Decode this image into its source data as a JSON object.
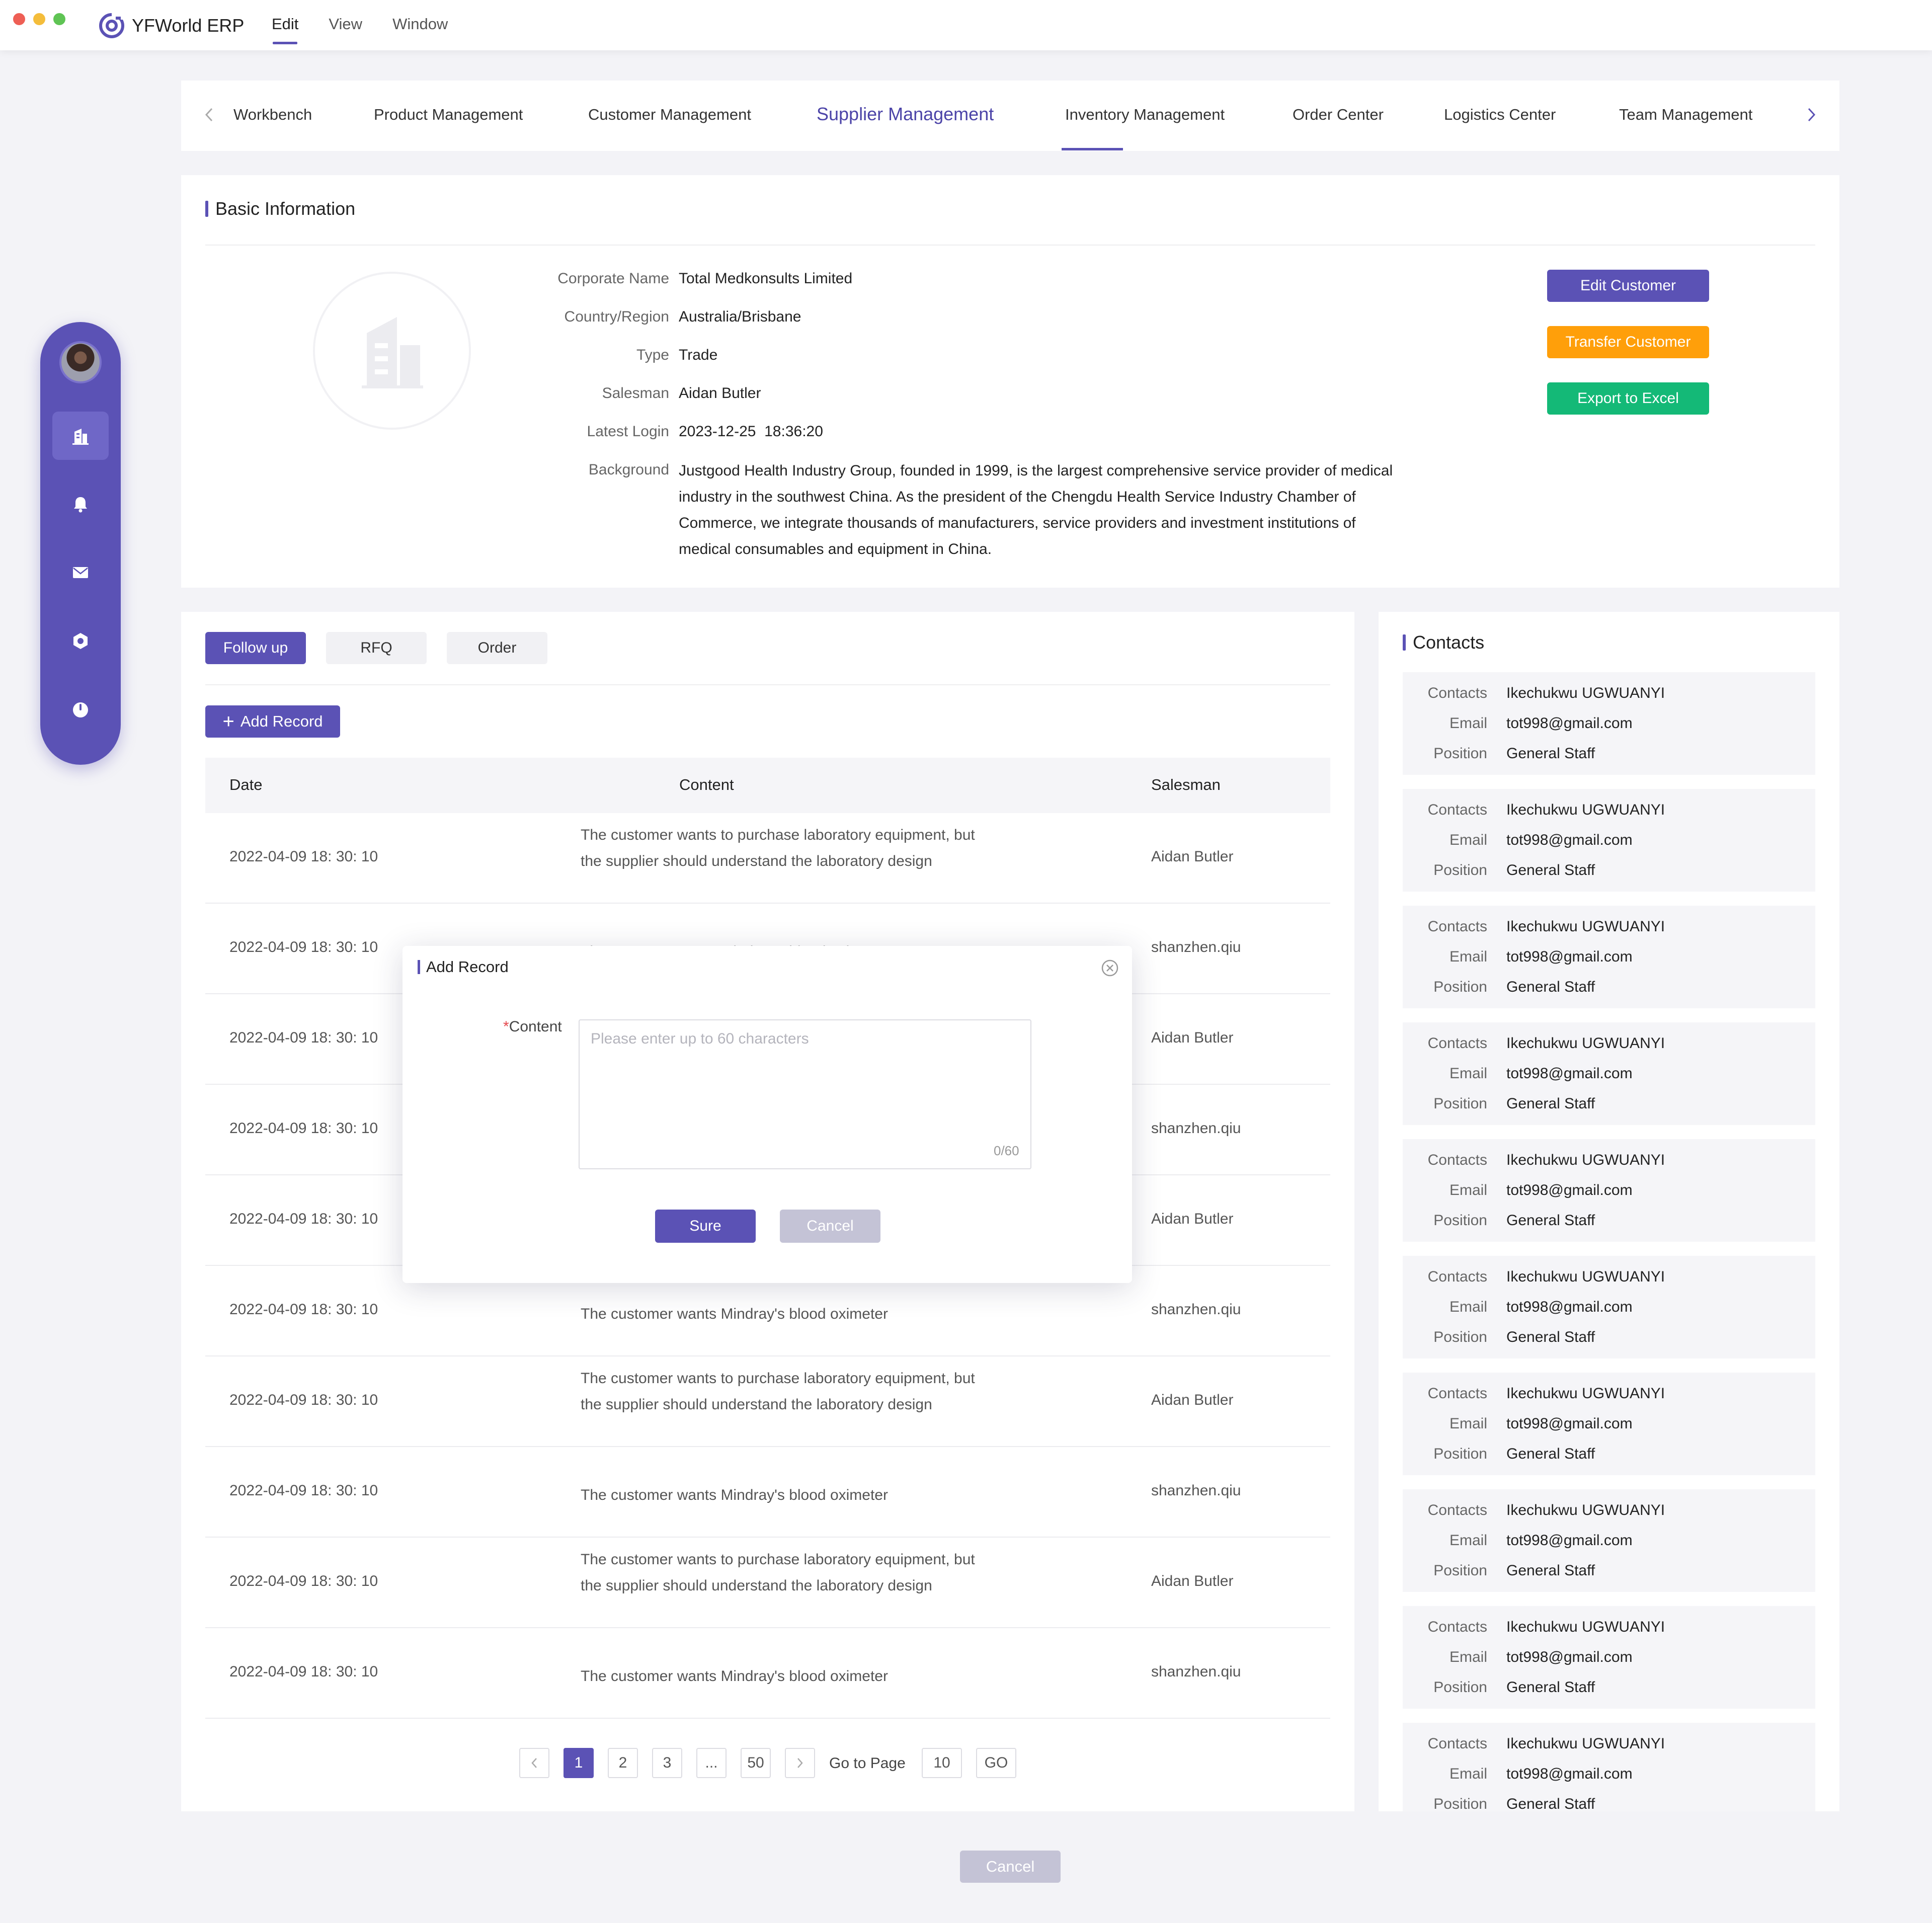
{
  "app": {
    "name": "YFWorld ERP",
    "menu": [
      "Edit",
      "View",
      "Window"
    ]
  },
  "nav": {
    "tabs": [
      "Workbench",
      "Product Management",
      "Customer Management",
      "Supplier Management",
      "Inventory Management",
      "Order Center",
      "Logistics Center",
      "Team Management"
    ],
    "active": "Supplier Management"
  },
  "rail": {
    "icons": [
      "building-icon",
      "bell-icon",
      "mail-icon",
      "settings-icon",
      "power-icon"
    ],
    "active": "building-icon"
  },
  "basic": {
    "title": "Basic Information",
    "fields": [
      {
        "label": "Corporate Name",
        "value": "Total Medkonsults Limited"
      },
      {
        "label": "Country/Region",
        "value": "Australia/Brisbane"
      },
      {
        "label": "Type",
        "value": "Trade"
      },
      {
        "label": "Salesman",
        "value": "Aidan Butler"
      },
      {
        "label": "Latest Login",
        "value": "2023-12-25  18:36:20"
      }
    ],
    "background_label": "Background",
    "background": "Justgood Health Industry Group, founded in 1999, is the largest comprehensive service provider of medical industry in the southwest China. As the president of the Chengdu Health Service Industry Chamber of Commerce, we integrate thousands of manufacturers, service providers and investment institutions of medical consumables and equipment in China.",
    "buttons": {
      "edit": "Edit Customer",
      "transfer": "Transfer Customer",
      "export": "Export to Excel"
    }
  },
  "records": {
    "tabs": [
      "Follow up",
      "RFQ",
      "Order"
    ],
    "active_tab": "Follow up",
    "add_label": "Add Record",
    "columns": [
      "Date",
      "Content",
      "Salesman"
    ],
    "rows": [
      {
        "date": "2022-04-09 18: 30: 10",
        "content": "The customer wants to purchase laboratory equipment, but the supplier should understand the laboratory design",
        "salesman": "Aidan Butler"
      },
      {
        "date": "2022-04-09 18: 30: 10",
        "content": "The customer wants Mindray's blood oximeter",
        "salesman": "shanzhen.qiu"
      },
      {
        "date": "2022-04-09 18: 30: 10",
        "content": "",
        "salesman": "Aidan Butler"
      },
      {
        "date": "2022-04-09 18: 30: 10",
        "content": "",
        "salesman": "shanzhen.qiu"
      },
      {
        "date": "2022-04-09 18: 30: 10",
        "content": "",
        "salesman": "Aidan Butler"
      },
      {
        "date": "2022-04-09 18: 30: 10",
        "content": "The customer wants Mindray's blood oximeter",
        "salesman": "shanzhen.qiu"
      },
      {
        "date": "2022-04-09 18: 30: 10",
        "content": "The customer wants to purchase laboratory equipment, but the supplier should understand the laboratory design",
        "salesman": "Aidan Butler"
      },
      {
        "date": "2022-04-09 18: 30: 10",
        "content": "The customer wants Mindray's blood oximeter",
        "salesman": "shanzhen.qiu"
      },
      {
        "date": "2022-04-09 18: 30: 10",
        "content": "The customer wants to purchase laboratory equipment, but the supplier should understand the laboratory design",
        "salesman": "Aidan Butler"
      },
      {
        "date": "2022-04-09 18: 30: 10",
        "content": "The customer wants Mindray's blood oximeter",
        "salesman": "shanzhen.qiu"
      }
    ],
    "pagination": {
      "pages": [
        "1",
        "2",
        "3",
        "...",
        "50"
      ],
      "current": "1",
      "goto_label": "Go to Page",
      "goto_value": "10",
      "go_label": "GO"
    }
  },
  "contacts": {
    "title": "Contacts",
    "labels": {
      "contact": "Contacts",
      "email": "Email",
      "position": "Position"
    },
    "items": [
      {
        "name": "Ikechukwu UGWUANYI",
        "email": "tot998@gmail.com",
        "position": "General Staff"
      },
      {
        "name": "Ikechukwu UGWUANYI",
        "email": "tot998@gmail.com",
        "position": "General Staff"
      },
      {
        "name": "Ikechukwu UGWUANYI",
        "email": "tot998@gmail.com",
        "position": "General Staff"
      },
      {
        "name": "Ikechukwu UGWUANYI",
        "email": "tot998@gmail.com",
        "position": "General Staff"
      },
      {
        "name": "Ikechukwu UGWUANYI",
        "email": "tot998@gmail.com",
        "position": "General Staff"
      },
      {
        "name": "Ikechukwu UGWUANYI",
        "email": "tot998@gmail.com",
        "position": "General Staff"
      },
      {
        "name": "Ikechukwu UGWUANYI",
        "email": "tot998@gmail.com",
        "position": "General Staff"
      },
      {
        "name": "Ikechukwu UGWUANYI",
        "email": "tot998@gmail.com",
        "position": "General Staff"
      },
      {
        "name": "Ikechukwu UGWUANYI",
        "email": "tot998@gmail.com",
        "position": "General Staff"
      },
      {
        "name": "Ikechukwu UGWUANYI",
        "email": "tot998@gmail.com",
        "position": "General Staff"
      }
    ]
  },
  "modal": {
    "title": "Add Record",
    "field_required_mark": "*",
    "field_label": "Content",
    "placeholder": "Please enter up to 60 characters",
    "value": "",
    "counter": "0/60",
    "sure": "Sure",
    "cancel": "Cancel"
  },
  "footer": {
    "cancel": "Cancel"
  },
  "colors": {
    "accent": "#5b52b5",
    "orange": "#ff9f0a",
    "green": "#14b977",
    "disabled": "#c4c3d6"
  }
}
